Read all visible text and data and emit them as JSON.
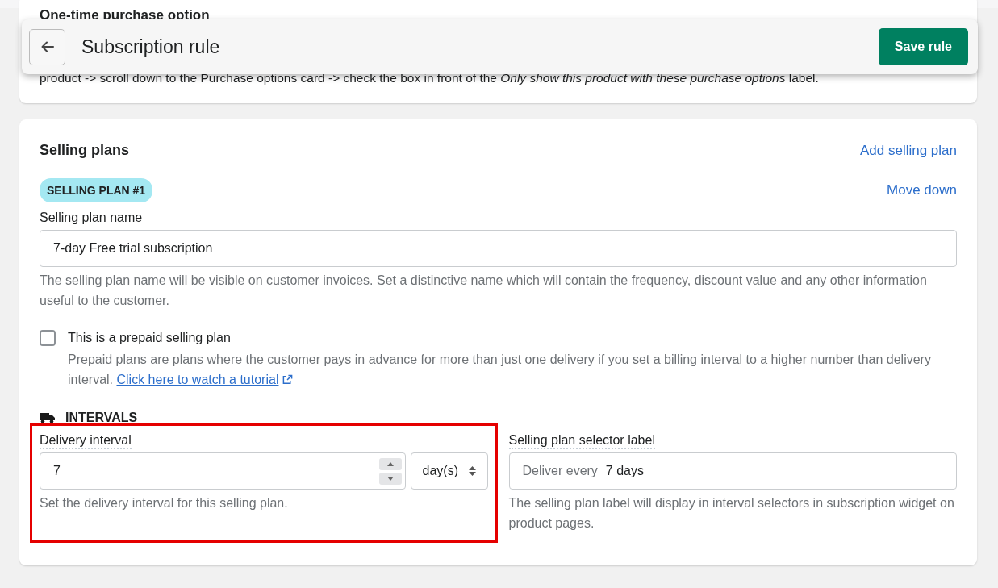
{
  "header": {
    "title": "Subscription rule",
    "save_button": "Save rule"
  },
  "one_time_card": {
    "heading": "One-time purchase option",
    "text": "product -> scroll down to the Purchase options card -> check the box in front of the *Only show this product with these purchase options* label."
  },
  "selling_plans": {
    "title": "Selling plans",
    "add_link": "Add selling plan",
    "badge": "SELLING PLAN #1",
    "move_link": "Move down",
    "name_field": {
      "label": "Selling plan name",
      "value": "7-day Free trial subscription",
      "help": "The selling plan name will be visible on customer invoices. Set a distinctive name which will contain the frequency, discount value and any other information useful to the customer."
    },
    "prepaid": {
      "label": "This is a prepaid selling plan",
      "checked": false,
      "help": "Prepaid plans are plans where the customer pays in advance for more than just one delivery if you set a billing interval to a higher number than delivery interval.",
      "link": "Click here to watch a tutorial"
    },
    "intervals_heading": "INTERVALS",
    "delivery_interval": {
      "label": "Delivery interval",
      "value": "7",
      "unit": "day(s)",
      "help": "Set the delivery interval for this selling plan.",
      "highlighted": true
    },
    "selector_label": {
      "label": "Selling plan selector label",
      "prefix": "Deliver every",
      "value": "7 days",
      "help": "The selling plan label will display in interval selectors in subscription widget on product pages."
    }
  }
}
